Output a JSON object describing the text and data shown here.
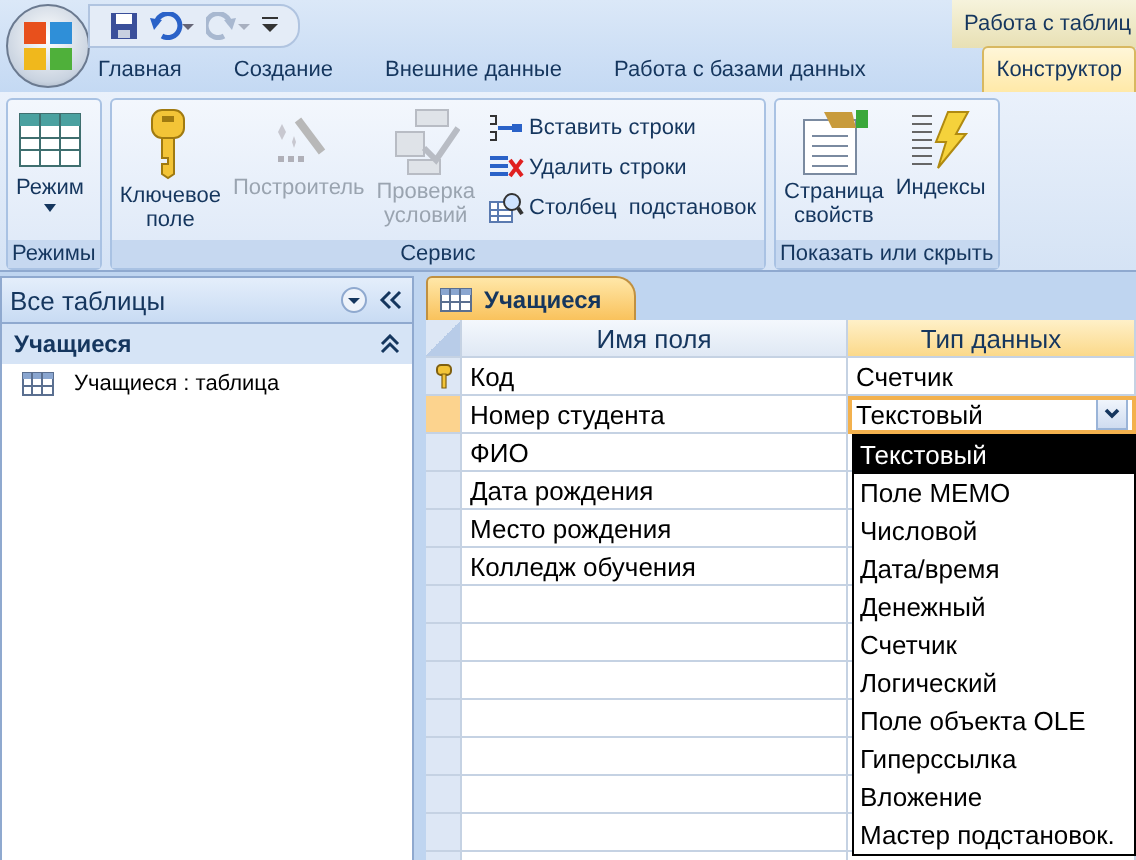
{
  "contextual_header": "Работа с таблиц",
  "ribbon_tabs": [
    {
      "label": "Главная",
      "selected": false
    },
    {
      "label": "Создание",
      "selected": false
    },
    {
      "label": "Внешние данные",
      "selected": false
    },
    {
      "label": "Работа с базами данных",
      "selected": false
    },
    {
      "label": "Конструктор",
      "selected": true
    }
  ],
  "ribbon_groups": [
    {
      "title": "Режимы",
      "buttons": [
        {
          "kind": "large",
          "label": "Режим",
          "disabled": false
        }
      ]
    },
    {
      "title": "Сервис",
      "buttons": [
        {
          "kind": "large",
          "label": "Ключевое\nполе",
          "disabled": false
        },
        {
          "kind": "large",
          "label": "Построитель",
          "disabled": true
        },
        {
          "kind": "large",
          "label": "Проверка\nусловий",
          "disabled": true
        },
        {
          "kind": "small",
          "label": "Вставить строки",
          "disabled": false
        },
        {
          "kind": "small",
          "label": "Удалить строки",
          "disabled": false
        },
        {
          "kind": "small",
          "label": "Столбец  подстановок",
          "disabled": false
        }
      ]
    },
    {
      "title": "Показать или скрыть",
      "buttons": [
        {
          "kind": "large",
          "label": "Страница\nсвойств",
          "disabled": false
        },
        {
          "kind": "large",
          "label": "Индексы",
          "disabled": false
        }
      ]
    }
  ],
  "nav_pane": {
    "title": "Все таблицы",
    "group": {
      "title": "Учащиеся",
      "expanded": true,
      "items": [
        {
          "label": "Учащиеся : таблица"
        }
      ]
    }
  },
  "document_tab": {
    "title": "Учащиеся"
  },
  "table": {
    "columns": [
      {
        "label": "Имя поля",
        "selected": false
      },
      {
        "label": "Тип данных",
        "selected": true
      }
    ],
    "rows": [
      {
        "field_name": "Код",
        "data_type": "Счетчик",
        "primary_key": true,
        "selected": false
      },
      {
        "field_name": "Номер студента",
        "data_type": "Текстовый",
        "primary_key": false,
        "selected": true
      },
      {
        "field_name": "ФИО",
        "primary_key": false,
        "selected": false
      },
      {
        "field_name": "Дата рождения",
        "primary_key": false,
        "selected": false
      },
      {
        "field_name": "Место рождения",
        "primary_key": false,
        "selected": false
      },
      {
        "field_name": "Колледж обучения",
        "primary_key": false,
        "selected": false
      }
    ]
  },
  "type_dropdown": {
    "options": [
      {
        "label": "Текстовый",
        "selected": true
      },
      {
        "label": "Поле MEMO",
        "selected": false
      },
      {
        "label": "Числовой",
        "selected": false
      },
      {
        "label": "Дата/время",
        "selected": false
      },
      {
        "label": "Денежный",
        "selected": false
      },
      {
        "label": "Счетчик",
        "selected": false
      },
      {
        "label": "Логический",
        "selected": false
      },
      {
        "label": "Поле объекта OLE",
        "selected": false
      },
      {
        "label": "Гиперссылка",
        "selected": false
      },
      {
        "label": "Вложение",
        "selected": false
      },
      {
        "label": "Мастер подстановок.",
        "selected": false
      }
    ]
  }
}
